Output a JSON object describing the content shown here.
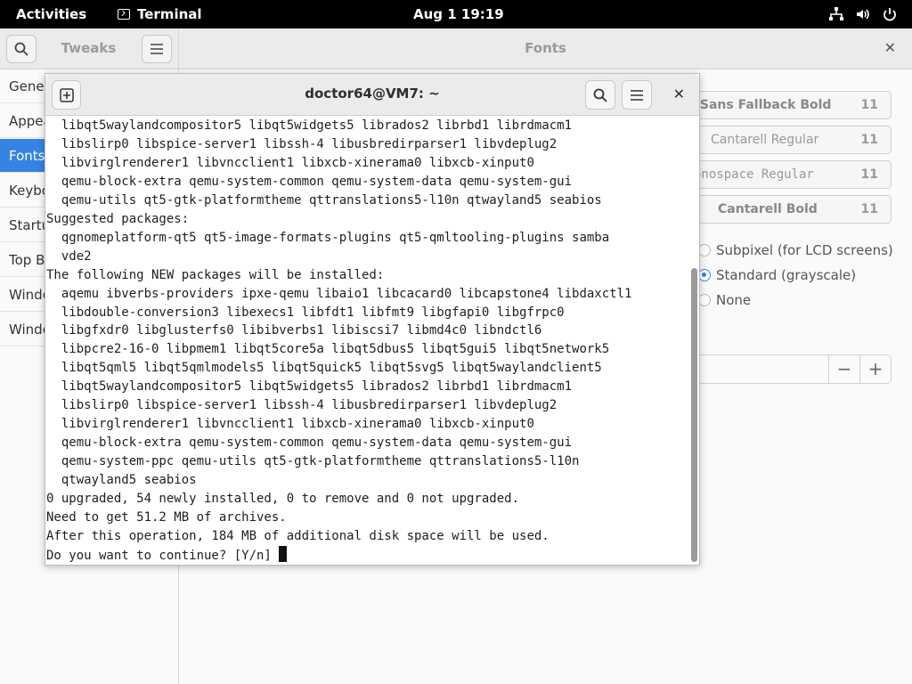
{
  "topbar": {
    "activities": "Activities",
    "app_name": "Terminal",
    "clock": "Aug 1  19:19",
    "tray_icons": [
      "network-icon",
      "volume-icon",
      "power-icon"
    ]
  },
  "tweaks": {
    "title": "Tweaks",
    "panel_title": "Fonts",
    "sidebar": [
      {
        "label": "General",
        "selected": false
      },
      {
        "label": "Appearance",
        "selected": false
      },
      {
        "label": "Fonts",
        "selected": true
      },
      {
        "label": "Keyboard & Mouse",
        "selected": false
      },
      {
        "label": "Startup Applications",
        "selected": false
      },
      {
        "label": "Top Bar",
        "selected": false
      },
      {
        "label": "Window Titlebars",
        "selected": false
      },
      {
        "label": "Windows",
        "selected": false
      }
    ],
    "fonts": [
      {
        "name": "d Sans Fallback Bold",
        "size": "11"
      },
      {
        "name": "Cantarell Regular",
        "size": "11"
      },
      {
        "name": "onospace Regular",
        "size": "11"
      },
      {
        "name": "Cantarell Bold",
        "size": "11"
      }
    ],
    "antialiasing": [
      {
        "label": "Subpixel (for LCD screens)",
        "checked": false
      },
      {
        "label": "Standard (grayscale)",
        "checked": true
      },
      {
        "label": "None",
        "checked": false
      }
    ],
    "scale_minus": "−",
    "scale_plus": "+"
  },
  "terminal": {
    "title": "doctor64@VM7: ~",
    "lines": [
      "  libqt5waylandcompositor5 libqt5widgets5 librados2 librbd1 librdmacm1",
      "  libslirp0 libspice-server1 libssh-4 libusbredirparser1 libvdeplug2",
      "  libvirglrenderer1 libvncclient1 libxcb-xinerama0 libxcb-xinput0",
      "  qemu-block-extra qemu-system-common qemu-system-data qemu-system-gui",
      "  qemu-utils qt5-gtk-platformtheme qttranslations5-l10n qtwayland5 seabios",
      "Suggested packages:",
      "  qgnomeplatform-qt5 qt5-image-formats-plugins qt5-qmltooling-plugins samba",
      "  vde2",
      "The following NEW packages will be installed:",
      "  aqemu ibverbs-providers ipxe-qemu libaio1 libcacard0 libcapstone4 libdaxctl1",
      "  libdouble-conversion3 libexecs1 libfdt1 libfmt9 libgfapi0 libgfrpc0",
      "  libgfxdr0 libglusterfs0 libibverbs1 libiscsi7 libmd4c0 libndctl6",
      "  libpcre2-16-0 libpmem1 libqt5core5a libqt5dbus5 libqt5gui5 libqt5network5",
      "  libqt5qml5 libqt5qmlmodels5 libqt5quick5 libqt5svg5 libqt5waylandclient5",
      "  libqt5waylandcompositor5 libqt5widgets5 librados2 librbd1 librdmacm1",
      "  libslirp0 libspice-server1 libssh-4 libusbredirparser1 libvdeplug2",
      "  libvirglrenderer1 libvncclient1 libxcb-xinerama0 libxcb-xinput0",
      "  qemu-block-extra qemu-system-common qemu-system-data qemu-system-gui",
      "  qemu-system-ppc qemu-utils qt5-gtk-platformtheme qttranslations5-l10n",
      "  qtwayland5 seabios",
      "0 upgraded, 54 newly installed, 0 to remove and 0 not upgraded.",
      "Need to get 51.2 MB of archives.",
      "After this operation, 184 MB of additional disk space will be used.",
      "Do you want to continue? [Y/n] "
    ]
  }
}
